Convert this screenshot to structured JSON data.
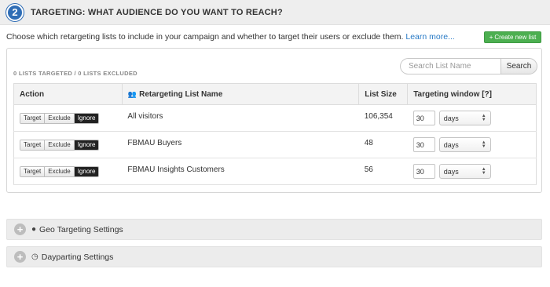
{
  "header": {
    "step": "2",
    "title": "TARGETING: WHAT AUDIENCE DO YOU WANT TO REACH?"
  },
  "intro": {
    "text": "Choose which retargeting lists to include in your campaign and whether to target their users or exclude them.",
    "link": "Learn more..."
  },
  "create_button": {
    "icon": "+",
    "label": "Create new list"
  },
  "panel": {
    "counts": "0 LISTS TARGETED / 0 LISTS EXCLUDED",
    "search": {
      "placeholder": "Search List Name",
      "button": "Search"
    },
    "table": {
      "headers": {
        "action": "Action",
        "name": "Retargeting List Name",
        "size": "List Size",
        "window": "Targeting window [?]"
      },
      "rows": [
        {
          "actions": [
            "Target",
            "Exclude",
            "Ignore"
          ],
          "active": "Ignore",
          "name": "All visitors",
          "size": "106,354",
          "window_value": "30",
          "window_unit": "days"
        },
        {
          "actions": [
            "Target",
            "Exclude",
            "Ignore"
          ],
          "active": "Ignore",
          "name": "FBMAU Buyers",
          "size": "48",
          "window_value": "30",
          "window_unit": "days"
        },
        {
          "actions": [
            "Target",
            "Exclude",
            "Ignore"
          ],
          "active": "Ignore",
          "name": "FBMAU Insights Customers",
          "size": "56",
          "window_value": "30",
          "window_unit": "days"
        }
      ]
    }
  },
  "accordions": [
    {
      "label": "Geo Targeting Settings",
      "icon": "globe-icon"
    },
    {
      "label": "Dayparting Settings",
      "icon": "clock-icon"
    }
  ],
  "colors": {
    "accent": "#2f6db5",
    "create": "#4caf50",
    "link": "#2a7bc6"
  }
}
